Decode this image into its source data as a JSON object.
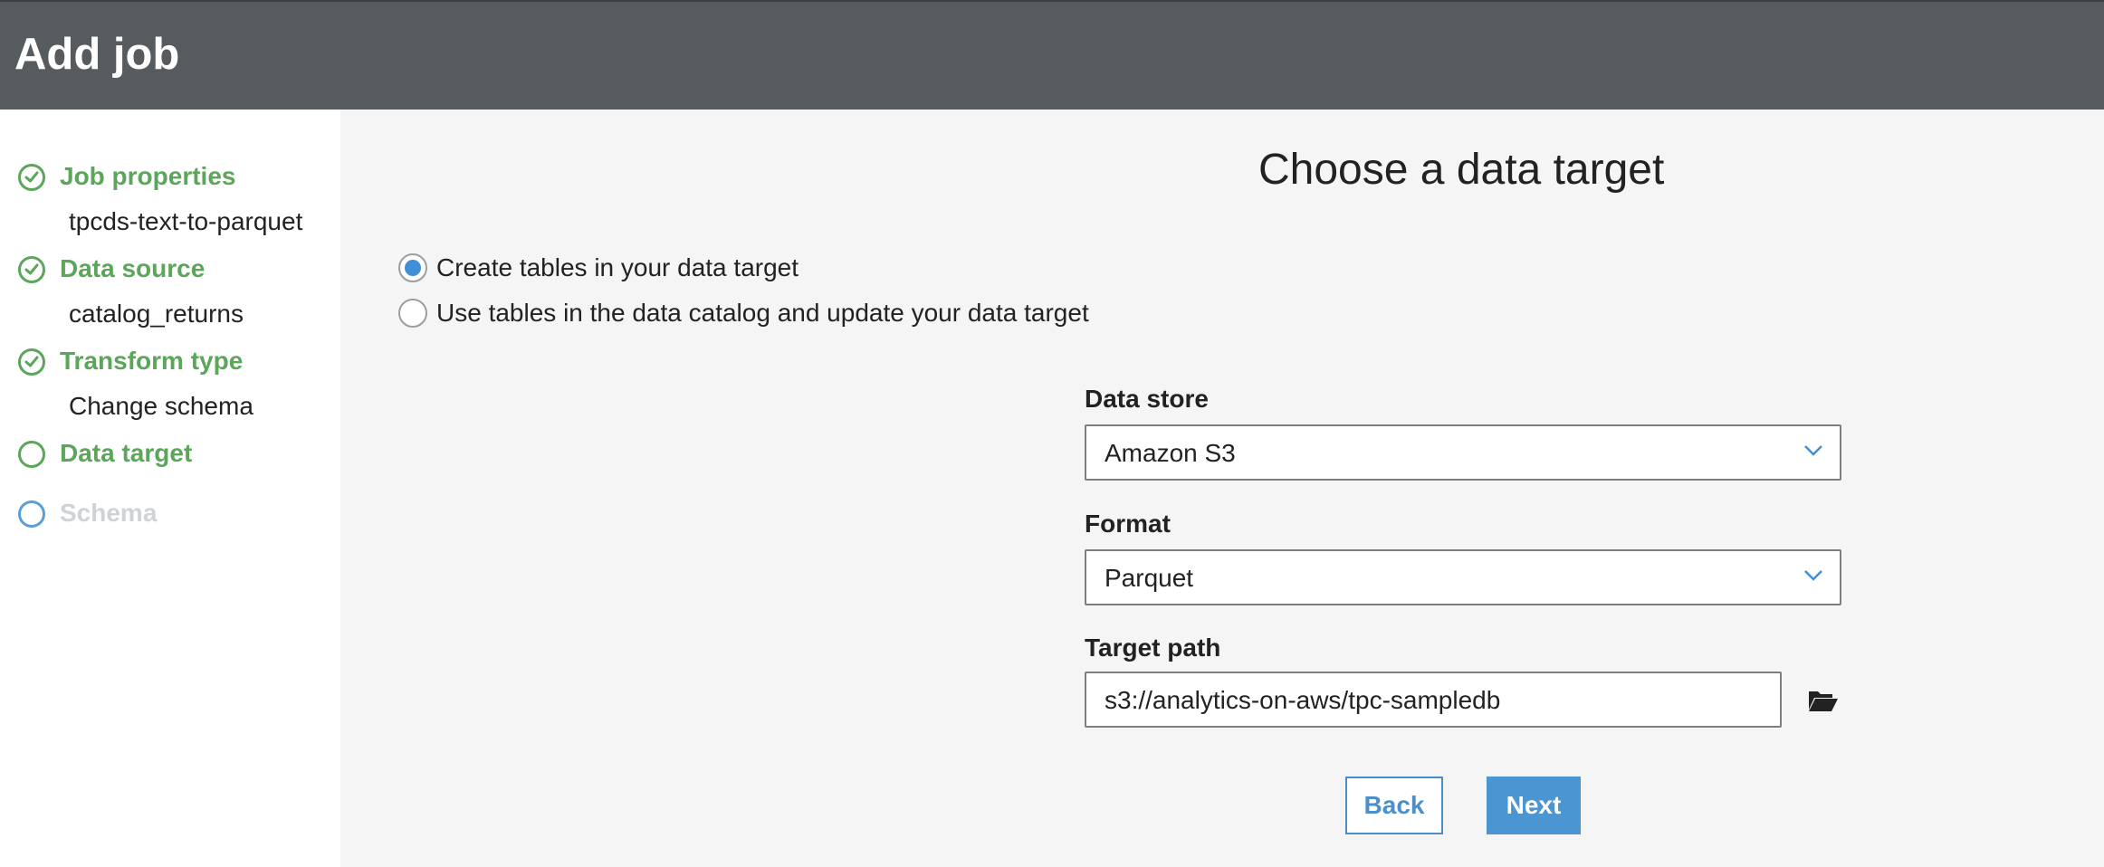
{
  "header": {
    "title": "Add job"
  },
  "sidebar": {
    "steps": [
      {
        "label": "Job properties",
        "status": "complete",
        "detail": "tpcds-text-to-parquet"
      },
      {
        "label": "Data source",
        "status": "complete",
        "detail": "catalog_returns"
      },
      {
        "label": "Transform type",
        "status": "complete",
        "detail": "Change schema"
      },
      {
        "label": "Data target",
        "status": "current"
      },
      {
        "label": "Schema",
        "status": "pending"
      }
    ]
  },
  "main": {
    "title": "Choose a data target",
    "options": [
      {
        "label": "Create tables in your data target",
        "selected": true
      },
      {
        "label": "Use tables in the data catalog and update your data target",
        "selected": false
      }
    ],
    "data_store": {
      "label": "Data store",
      "value": "Amazon S3"
    },
    "format": {
      "label": "Format",
      "value": "Parquet"
    },
    "target_path": {
      "label": "Target path",
      "value": "s3://analytics-on-aws/tpc-sampledb"
    },
    "buttons": {
      "back": "Back",
      "next": "Next"
    }
  },
  "colors": {
    "header_bg": "#555b5e",
    "complete_green": "#5ba65a",
    "accent_blue": "#4b95d3",
    "muted_text": "#cfd3d6"
  },
  "icons": {
    "complete": "check-circle-icon",
    "current": "circle-icon",
    "pending": "circle-icon",
    "dropdown": "chevron-down-icon",
    "browse": "folder-open-icon"
  }
}
